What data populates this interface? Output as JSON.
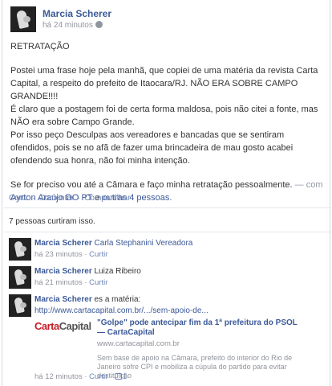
{
  "post": {
    "author": "Marcia Scherer",
    "time": "há 24 minutos",
    "paragraphs": [
      "RETRATAÇÃO",
      "Postei uma frase hoje pela manhã, que copiei de uma matéria da revista Carta Capital, a respeito do prefeito de Itaocara/RJ. NÃO ERA SOBRE CAMPO GRANDE!!!!",
      "É claro que a postagem foi de certa forma maldosa, pois não citei a fonte, mas NÃO era sobre Campo Grande.",
      "Por isso peço Desculpas aos vereadores e bancadas que se sentiram ofendidos, pois se no afã de fazer uma brincadeira de mau gosto acabei ofendendo sua honra, não foi minha intenção.",
      "Se for preciso vou até a Câmara e faço minha retratação pessoalmente."
    ],
    "with_prefix": "— com",
    "with_person": "Ayrton Araújo DO PT",
    "with_conj": "e",
    "with_others": "outras 4 pessoas."
  },
  "actions": {
    "like": "Curtir",
    "comment": "Comentar",
    "share": "Compartilhar",
    "dot": "·"
  },
  "likes_text": "7 pessoas curtiram isso.",
  "comments": [
    {
      "author": "Marcia Scherer",
      "text": "Carla Stephanini Vereadora",
      "time": "há 23 minutos",
      "like": "Curtir"
    },
    {
      "author": "Marcia Scherer",
      "text": "Luiza Ribeiro",
      "time": "há 21 minutos",
      "like": "Curtir"
    },
    {
      "author": "Marcia Scherer",
      "text": "es a matéria:",
      "url": "http://www.cartacapital.com.br/.../sem-apoio-de...",
      "time": "há 12 minutos",
      "like": "Curtir",
      "like_count": "1"
    }
  ],
  "preview": {
    "logo_a": "Carta",
    "logo_b": "Capital",
    "title": "\"Golpe\" pode antecipar fim da 1ª prefeitura do PSOL — CartaCapital",
    "domain": "www.cartacapital.com.br",
    "desc": "Sem base de apoio na Câmara, prefeito do interior do Rio de Janeiro sofre CPI e mobiliza a cúpula do partido para evitar destituição"
  },
  "colors": {
    "link": "#3b5998",
    "muted": "#90949c",
    "action": "#6d84b4",
    "brand_red": "#c8202a"
  }
}
